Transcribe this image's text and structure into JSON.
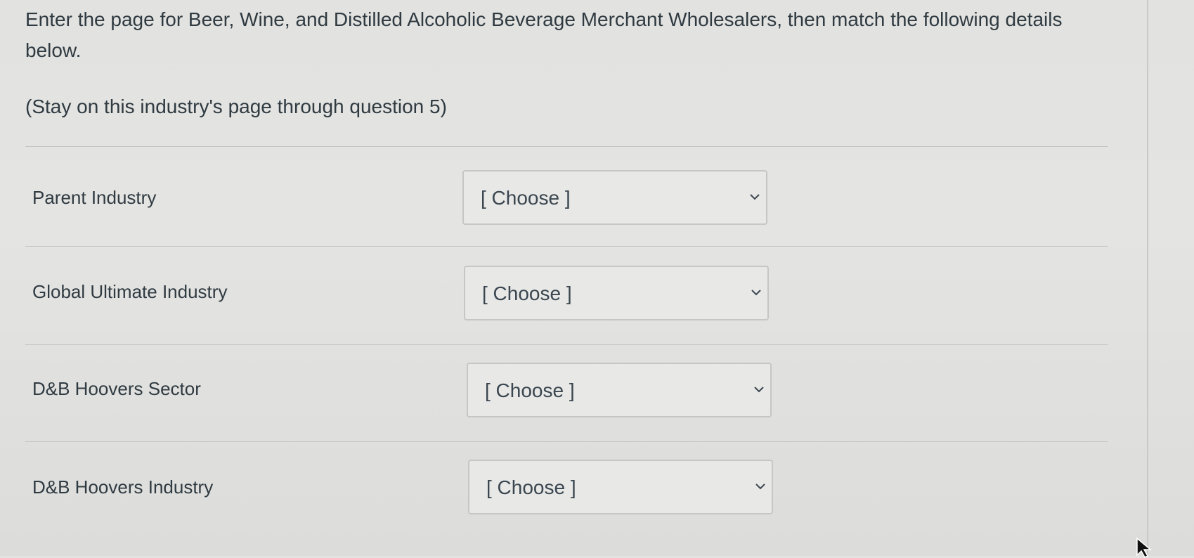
{
  "question": {
    "prompt": "Enter the page for Beer, Wine, and Distilled Alcoholic Beverage Merchant Wholesalers, then match the following details below.",
    "note": "(Stay on this industry's page through question 5)"
  },
  "matches": [
    {
      "label": "Parent Industry",
      "selected": "[ Choose ]",
      "icon": "chevron-down-icon"
    },
    {
      "label": "Global Ultimate Industry",
      "selected": "[ Choose ]",
      "icon": "chevron-down-icon"
    },
    {
      "label": "D&B Hoovers Sector",
      "selected": "[ Choose ]",
      "icon": "chevron-down-icon"
    },
    {
      "label": "D&B Hoovers Industry",
      "selected": "[ Choose ]",
      "icon": "chevron-down-icon"
    }
  ],
  "colors": {
    "background": "#e2e2e0",
    "text": "#2f3a41",
    "border": "#c6c6c4"
  }
}
